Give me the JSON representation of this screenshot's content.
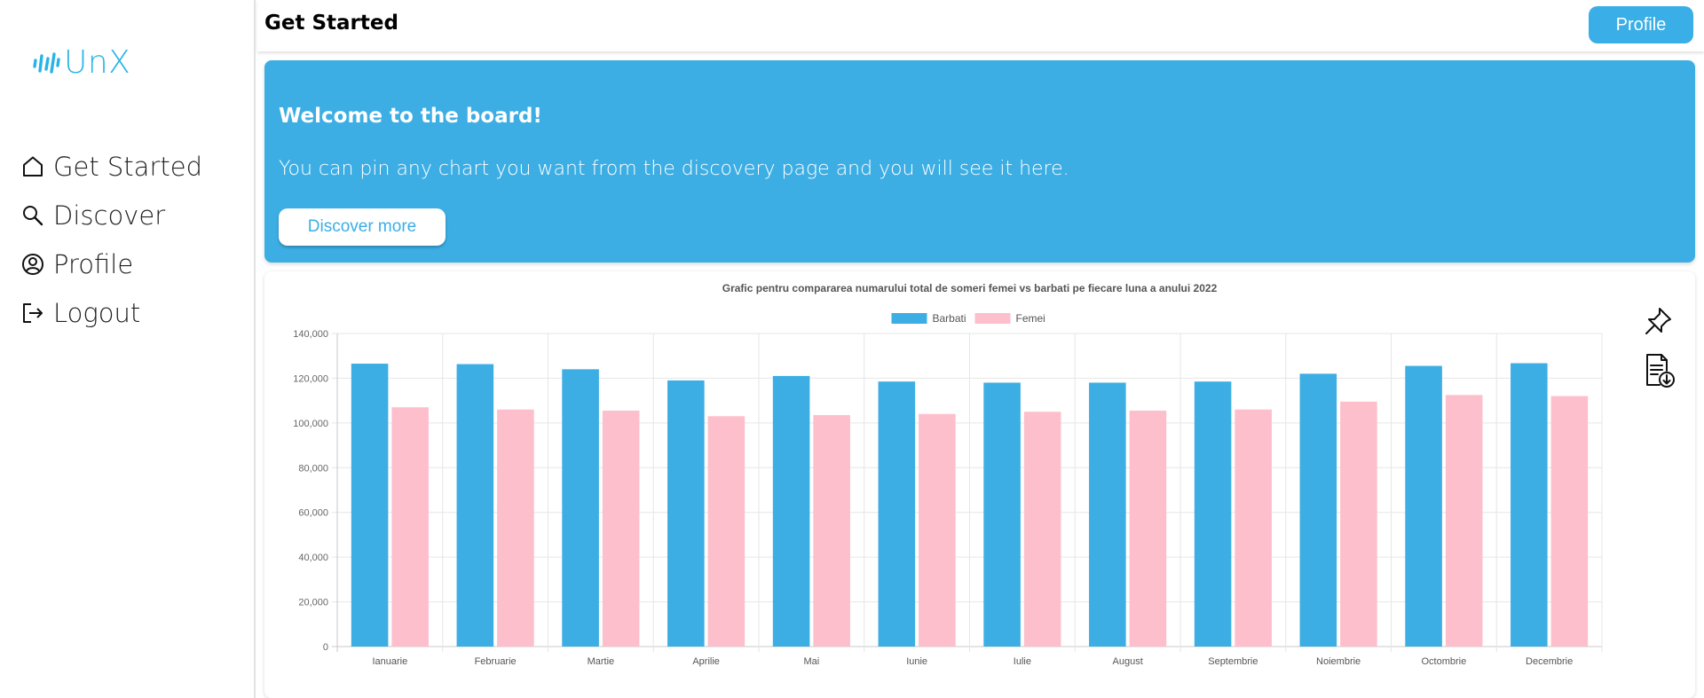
{
  "app": {
    "logo_text": "UnX"
  },
  "sidebar": {
    "items": [
      {
        "label": "Get Started",
        "icon": "home-icon"
      },
      {
        "label": "Discover",
        "icon": "search-icon"
      },
      {
        "label": "Profile",
        "icon": "user-circle-icon"
      },
      {
        "label": "Logout",
        "icon": "logout-icon"
      }
    ]
  },
  "header": {
    "title": "Get Started",
    "profile_label": "Profile"
  },
  "banner": {
    "title": "Welcome to the board!",
    "text": "You can pin any chart you want from the discovery page and you will see it here.",
    "button_label": "Discover more"
  },
  "colors": {
    "accent": "#3daee4",
    "barbati": "#3caee3",
    "femei": "#fdbfcc"
  },
  "chart_tools": {
    "pin_icon": "pin-icon",
    "download_icon": "file-download-icon"
  },
  "chart_data": {
    "type": "bar",
    "title": "Grafic pentru compararea numarului total de someri femei vs barbati pe fiecare luna a anului 2022",
    "categories": [
      "Ianuarie",
      "Februarie",
      "Martie",
      "Aprilie",
      "Mai",
      "Iunie",
      "Iulie",
      "August",
      "Septembrie",
      "Noiembrie",
      "Octombrie",
      "Decembrie"
    ],
    "series": [
      {
        "name": "Barbati",
        "values": [
          126500,
          126300,
          124000,
          119000,
          121000,
          118500,
          118000,
          118000,
          118500,
          122000,
          125500,
          126700
        ]
      },
      {
        "name": "Femei",
        "values": [
          107000,
          106000,
          105500,
          103000,
          103500,
          104000,
          105000,
          105500,
          106000,
          109500,
          112500,
          112000
        ]
      }
    ],
    "ylim": [
      0,
      140000
    ],
    "yticks": [
      "0",
      "20,000",
      "40,000",
      "60,000",
      "80,000",
      "100,000",
      "120,000",
      "140,000"
    ],
    "xlabel": "",
    "ylabel": "",
    "legend": "top-center",
    "grid": true
  }
}
